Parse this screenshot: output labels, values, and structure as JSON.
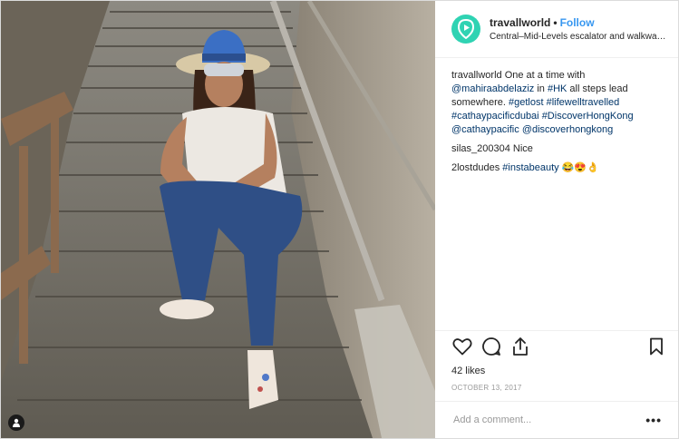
{
  "post": {
    "username": "travallworld",
    "follow_label": "Follow",
    "separator": "•",
    "location": "Central–Mid-Levels escalator and walkway...",
    "likes": "42 likes",
    "date": "OCTOBER 13, 2017",
    "add_comment_placeholder": "Add a comment...",
    "more_label": "•••"
  },
  "caption": {
    "user": "travallworld",
    "text_1": "One at a time with",
    "mention_1": "@mahiraabdelaziz",
    "text_2": "in",
    "tag_hk": "#HK",
    "text_3": "all steps lead somewhere.",
    "tag_getlost": "#getlost",
    "tag_lifewelltravelled": "#lifewelltravelled",
    "tag_cathaypacificdubai": "#cathaypacificdubai",
    "tag_discoverhongkong": "#DiscoverHongKong",
    "mention_cathay": "@cathaypacific",
    "mention_discover": "@discoverhongkong"
  },
  "comments": [
    {
      "user": "silas_200304",
      "text": "Nice"
    },
    {
      "user": "2lostdudes",
      "tag": "#instabeauty",
      "emoji": "😂😍👌"
    }
  ],
  "icons": {
    "avatar": "play-in-pin-icon",
    "like": "heart-icon",
    "comment": "comment-bubble-icon",
    "share": "share-icon",
    "save": "bookmark-icon",
    "tagged": "person-icon"
  },
  "colors": {
    "link": "#003569",
    "follow": "#3897f0",
    "avatar": "#2fd3b3"
  }
}
